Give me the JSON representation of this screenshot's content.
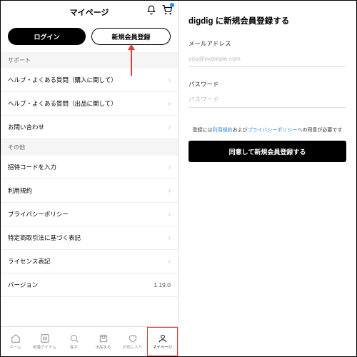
{
  "left": {
    "title": "マイページ",
    "login": "ログイン",
    "signup": "新規会員登録",
    "sections": [
      {
        "header": "サポート",
        "items": [
          {
            "label": "ヘルプ・よくある質問（購入に関して）"
          },
          {
            "label": "ヘルプ・よくある質問（出品に関して）"
          },
          {
            "label": "お問い合わせ"
          }
        ]
      },
      {
        "header": "その他",
        "items": [
          {
            "label": "招待コードを入力"
          },
          {
            "label": "利用規約"
          },
          {
            "label": "プライバシーポリシー"
          },
          {
            "label": "特定商取引法に基づく表記"
          },
          {
            "label": "ライセンス表記"
          },
          {
            "label": "バージョン",
            "value": "1.19.0",
            "noarrow": true
          }
        ]
      }
    ],
    "nav": [
      {
        "label": "ホーム"
      },
      {
        "label": "新着アイテム"
      },
      {
        "label": "探す"
      },
      {
        "label": "出品する"
      },
      {
        "label": "お気に入り"
      },
      {
        "label": "マイページ"
      }
    ]
  },
  "right": {
    "title_a": "digdig",
    "title_b": " に新規会員登録する",
    "email_label": "メールアドレス",
    "email_ph": "you@example.com",
    "pw_label": "パスワード",
    "pw_ph": "パスワード",
    "agree_a": "登録には",
    "agree_b": "利用規約",
    "agree_c": "および",
    "agree_d": "プライバシーポリシー",
    "agree_e": "への同意が必要です",
    "submit": "同意して新規会員登録する"
  }
}
